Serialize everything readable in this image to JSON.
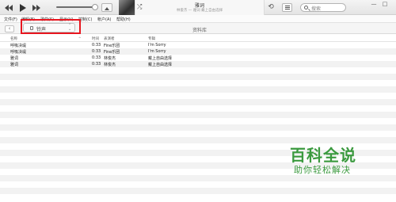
{
  "player": {
    "now_playing_title": "雅词",
    "now_playing_subtitle": "林俊杰 — 雅词 戴上自由选择",
    "search_placeholder": "搜索",
    "window_minimize": "—",
    "window_maximize": "□"
  },
  "menu": {
    "items": [
      "文件(F)",
      "编辑(E)",
      "歌曲(S)",
      "显示(V)",
      "控制(C)",
      "帐户(A)",
      "帮助(H)"
    ]
  },
  "toolbar": {
    "back_label": "‹",
    "source_label": "铃声",
    "library_title": "资料库"
  },
  "table": {
    "columns": [
      "名称",
      "时间",
      "表演者",
      "专辑"
    ],
    "rows": [
      {
        "name": "呼吸决堤",
        "time": "0:33",
        "artist": "Fine乐团",
        "album": "I'm Sorry"
      },
      {
        "name": "呼吸决堤",
        "time": "0:33",
        "artist": "Fine乐团",
        "album": "I'm Sorry"
      },
      {
        "name": "雅词",
        "time": "0:33",
        "artist": "林俊杰",
        "album": "戴上自由选择"
      },
      {
        "name": "雅词",
        "time": "0:33",
        "artist": "林俊杰",
        "album": "戴上自由选择"
      }
    ]
  },
  "watermark": {
    "main": "百科全说",
    "sub": "助你轻松解决"
  },
  "colors": {
    "highlight": "#e8161f",
    "watermark": "#3b9a3f"
  }
}
